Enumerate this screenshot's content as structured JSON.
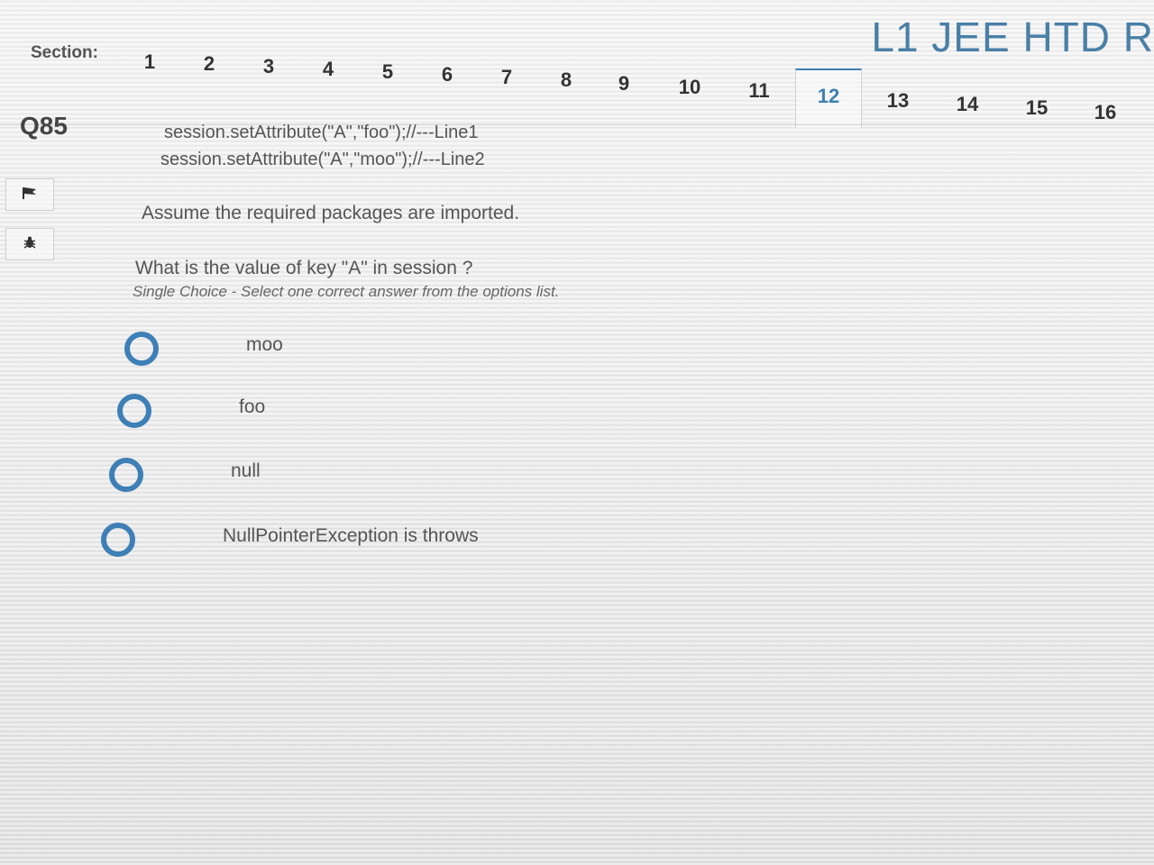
{
  "header": {
    "exam_title": "L1 JEE HTD R",
    "section_label": "Section:",
    "sections": [
      "1",
      "2",
      "3",
      "4",
      "5",
      "6",
      "7",
      "8",
      "9",
      "10",
      "11",
      "12",
      "13",
      "14",
      "15",
      "16"
    ],
    "active_section": "12"
  },
  "question": {
    "number": "Q85",
    "code_lines": [
      "session.setAttribute(\"A\",\"foo\");//---Line1",
      "session.setAttribute(\"A\",\"moo\");//---Line2"
    ],
    "assumption": "Assume the required packages are imported.",
    "prompt": "What is the value of key \"A\" in session ?",
    "hint": "Single Choice - Select one correct answer from the options list.",
    "options": [
      "moo",
      "foo",
      "null",
      "NullPointerException is throws"
    ]
  },
  "side_buttons": {
    "flag_icon": "flag-icon",
    "bug_icon": "bug-icon"
  },
  "colors": {
    "accent": "#3e7fb6",
    "title": "#4a7fa6"
  }
}
